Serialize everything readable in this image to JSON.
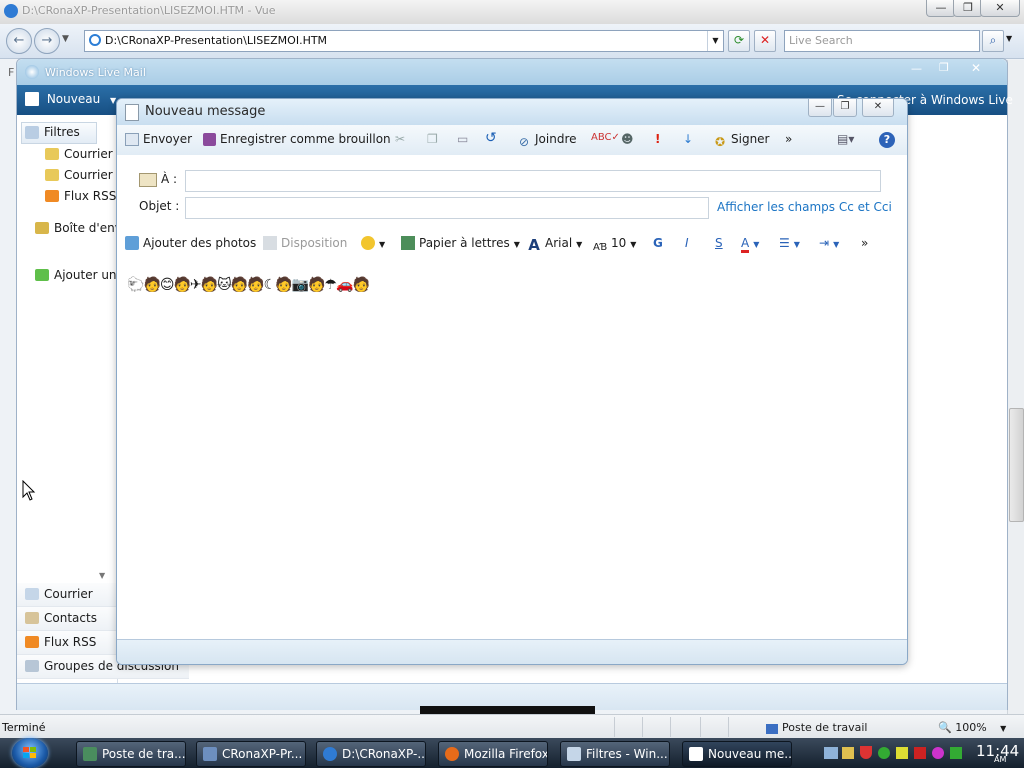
{
  "ie": {
    "title": "D:\\CRonaXP-Presentation\\LISEZMOI.HTM - Vue",
    "address": "D:\\CRonaXP-Presentation\\LISEZMOI.HTM",
    "search_placeholder": "Live Search",
    "side_letter": "F",
    "status": "Terminé",
    "zone": "Poste de travail",
    "zoom": "100%"
  },
  "wlm": {
    "title": "Windows Live Mail",
    "new_button": "Nouveau",
    "signin": "Se connecter à Windows Live",
    "tree": {
      "filters": "Filtres",
      "courrier1": "Courrier i",
      "courrier2": "Courrier n",
      "flux": "Flux RSS",
      "outbox": "Boîte d'envo",
      "add_account": "Ajouter un co"
    },
    "nav": {
      "courrier": "Courrier",
      "contacts": "Contacts",
      "flux": "Flux RSS",
      "groups": "Groupes de discussion"
    }
  },
  "compose": {
    "title": "Nouveau message",
    "toolbar": {
      "send": "Envoyer",
      "save_draft": "Enregistrer comme brouillon",
      "attach": "Joindre",
      "sign": "Signer",
      "more": "»"
    },
    "fields": {
      "to_label": "À :",
      "subject_label": "Objet :",
      "show_cc": "Afficher les champs Cc et Cci"
    },
    "format": {
      "add_photos": "Ajouter des photos",
      "layout": "Disposition",
      "stationery": "Papier à lettres",
      "font": "Arial",
      "size": "10",
      "bold": "G",
      "italic": "I",
      "underline": "S",
      "more": "»"
    }
  },
  "taskbar": {
    "items": [
      "Poste de tra...",
      "CRonaXP-Pr...",
      "D:\\CRonaXP-...",
      "Mozilla Firefox",
      "Filtres - Win...",
      "Nouveau me..."
    ],
    "clock": "11:44",
    "ampm": "AM"
  },
  "colors": {
    "wlm_toolbar": "#1d5a90",
    "link": "#1b74c4",
    "taskbar": "#1b2838"
  }
}
